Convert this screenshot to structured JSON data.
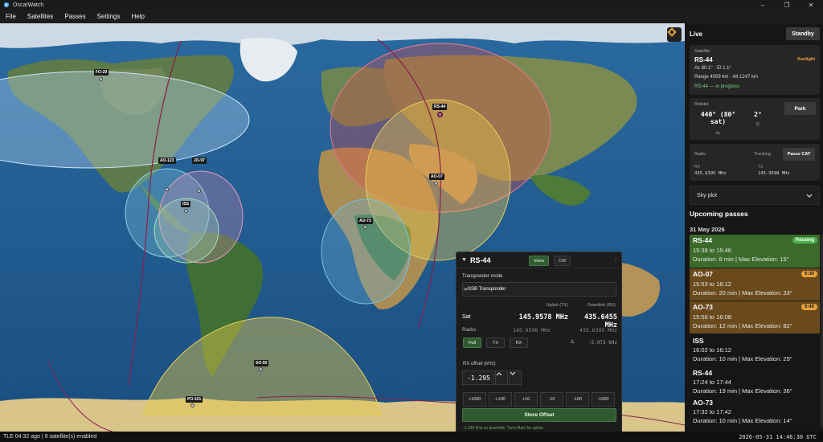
{
  "window": {
    "title": "OscarWatch",
    "minimize": "–",
    "maximize": "❐",
    "close": "✕"
  },
  "menu": [
    "File",
    "Satellites",
    "Passes",
    "Settings",
    "Help"
  ],
  "map": {
    "satellites": [
      {
        "name": "FO-29"
      },
      {
        "name": "RS-44"
      },
      {
        "name": "AO-07"
      },
      {
        "name": "AO-123"
      },
      {
        "name": "JO-97"
      },
      {
        "name": "ISS"
      },
      {
        "name": "AO-73"
      },
      {
        "name": "SO-50"
      },
      {
        "name": "PO-101"
      }
    ]
  },
  "transponder_panel": {
    "sat_name": "RS-44",
    "tabs": [
      "Voice",
      "CW"
    ],
    "mode_label": "Transponder mode",
    "mode_value": "SSB Transponder",
    "uplink_header": "Uplink (TX)",
    "downlink_header": "Downlink (RX)",
    "sat_label": "Sat",
    "sat_uplink": "145.9578 MHz",
    "sat_downlink": "435.6455 MHz",
    "radio_label": "Radio",
    "radio_uplink": "145.9598 MHz",
    "radio_downlink": "435.6395 MHz",
    "mode_buttons": [
      "Full",
      "TX",
      "RX"
    ],
    "delta_label": "Δ",
    "delta_value": "-5.973 kHz",
    "rx_offset_label": "RX offset (kHz)",
    "rx_offset_value": "-1.295",
    "steps": [
      "+1000",
      "+100",
      "+10",
      "-10",
      "-100",
      "-1000"
    ],
    "store_button": "Store Offset",
    "hint": "-1.295 kHz on downlink. Tune Main for uplink."
  },
  "sidebar": {
    "live_label": "Live",
    "standby_button": "Standby",
    "satellite_card": {
      "header": "Satellite",
      "name": "RS-44",
      "sunlight": "Sunlight",
      "az_el": "Az 80.1° · El 1.1°",
      "range_alt": "Range 4059 km · Alt 1247 km",
      "status": "RS-44 — in progress"
    },
    "rotator_card": {
      "header": "Rotator",
      "az_value": "440° (80° sat)",
      "az_label": "Az",
      "el_value": "2°",
      "el_label": "El",
      "park_button": "Park"
    },
    "radio_card": {
      "header": "Radio",
      "tracking_label": "Tracking",
      "pause_button": "Pause CAT",
      "rx_label": "RX",
      "rx_value": "435.6395 MHz",
      "tx_label": "TX",
      "tx_value": "145.9598 MHz"
    },
    "skyplot_label": "Sky plot",
    "upcoming_title": "Upcoming passes",
    "date": "31 May 2026",
    "passes": [
      {
        "name": "RS-44",
        "time": "15:38 to 15:46",
        "details": "Duration: 8 min | Max Elevation: 15°",
        "badge": "Passing"
      },
      {
        "name": "AO-07",
        "time": "15:53 to 16:12",
        "details": "Duration: 20 min | Max Elevation: 33°",
        "badge": "6:30"
      },
      {
        "name": "AO-73",
        "time": "15:56 to 16:08",
        "details": "Duration: 12 min | Max Elevation: 82°",
        "badge": "9:40"
      },
      {
        "name": "ISS",
        "time": "16:02 to 16:12",
        "details": "Duration: 10 min | Max Elevation: 29°",
        "badge": ""
      },
      {
        "name": "RS-44",
        "time": "17:24 to 17:44",
        "details": "Duration: 19 min | Max Elevation: 36°",
        "badge": ""
      },
      {
        "name": "AO-73",
        "time": "17:32 to 17:42",
        "details": "Duration: 10 min | Max Elevation: 14°",
        "badge": ""
      }
    ]
  },
  "status": {
    "left": "TLE 04:32 ago | 9 satellite(s) enabled",
    "right": "2026-05-31  14:46:30 UTC"
  },
  "colors": {
    "accent_green": "#2f5a2f",
    "passing_bg": "#3b6a2b",
    "soon_bg": "#6a4a1c",
    "badge_orange": "#e8a33c"
  }
}
